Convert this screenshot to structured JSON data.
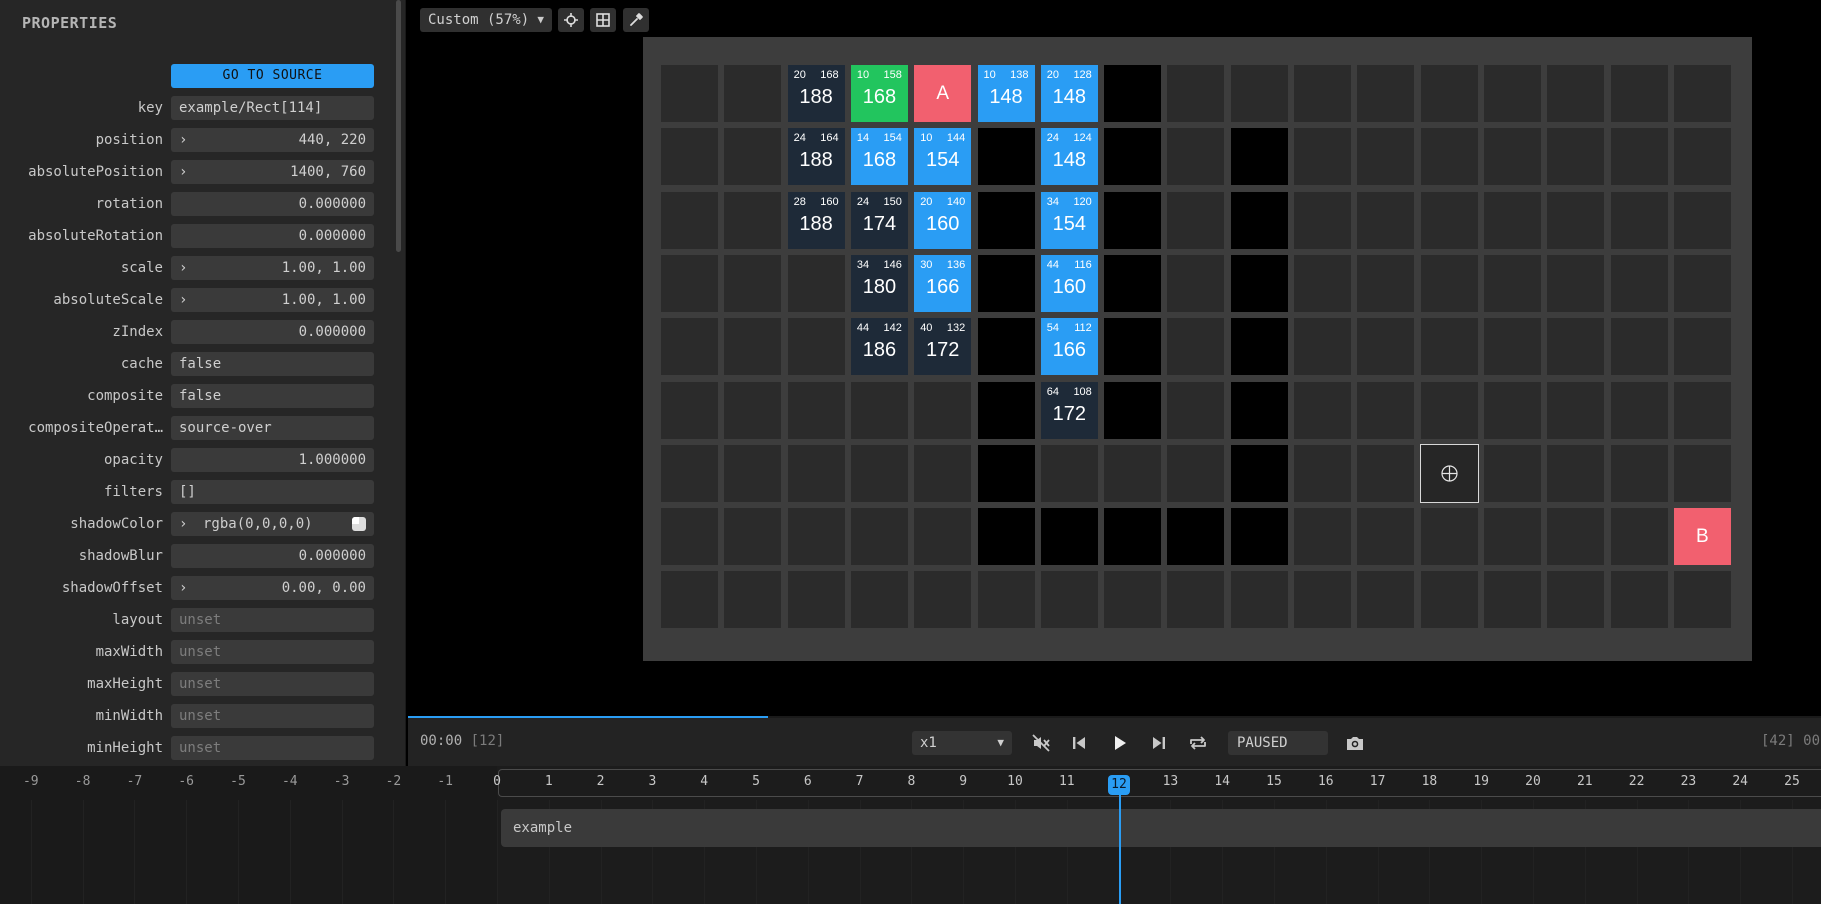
{
  "properties": {
    "title": "PROPERTIES",
    "go_to_source": "GO TO SOURCE",
    "rows": [
      {
        "label": "key",
        "value": "example/Rect[114]",
        "align": "left"
      },
      {
        "label": "position",
        "value": "440, 220",
        "align": "right",
        "expand": true
      },
      {
        "label": "absolutePosition",
        "value": "1400, 760",
        "align": "right",
        "expand": true
      },
      {
        "label": "rotation",
        "value": "0.000000",
        "align": "right"
      },
      {
        "label": "absoluteRotation",
        "value": "0.000000",
        "align": "right"
      },
      {
        "label": "scale",
        "value": "1.00, 1.00",
        "align": "right",
        "expand": true
      },
      {
        "label": "absoluteScale",
        "value": "1.00, 1.00",
        "align": "right",
        "expand": true
      },
      {
        "label": "zIndex",
        "value": "0.000000",
        "align": "right"
      },
      {
        "label": "cache",
        "value": "false",
        "align": "left"
      },
      {
        "label": "composite",
        "value": "false",
        "align": "left"
      },
      {
        "label": "compositeOperat…",
        "value": "source-over",
        "align": "left"
      },
      {
        "label": "opacity",
        "value": "1.000000",
        "align": "right"
      },
      {
        "label": "filters",
        "value": "[]",
        "align": "left"
      },
      {
        "label": "shadowColor",
        "value": "rgba(0,0,0,0)",
        "align": "left",
        "expand": true,
        "swatch": true
      },
      {
        "label": "shadowBlur",
        "value": "0.000000",
        "align": "right"
      },
      {
        "label": "shadowOffset",
        "value": "0.00, 0.00",
        "align": "right",
        "expand": true
      },
      {
        "label": "layout",
        "value": "unset",
        "align": "left",
        "muted": true
      },
      {
        "label": "maxWidth",
        "value": "unset",
        "align": "left",
        "muted": true
      },
      {
        "label": "maxHeight",
        "value": "unset",
        "align": "left",
        "muted": true
      },
      {
        "label": "minWidth",
        "value": "unset",
        "align": "left",
        "muted": true
      },
      {
        "label": "minHeight",
        "value": "unset",
        "align": "left",
        "muted": true
      }
    ]
  },
  "toolbar": {
    "zoom": "Custom (57%)",
    "icons": [
      "crosshair-icon",
      "grid-icon",
      "eyedropper-icon"
    ]
  },
  "grid": {
    "cols": 17,
    "rows": 9,
    "walls": [
      [
        7,
        0
      ],
      [
        7,
        1
      ],
      [
        7,
        2
      ],
      [
        7,
        3
      ],
      [
        7,
        4
      ],
      [
        7,
        5
      ],
      [
        9,
        1
      ],
      [
        9,
        2
      ],
      [
        9,
        3
      ],
      [
        9,
        4
      ],
      [
        9,
        5
      ],
      [
        9,
        6
      ],
      [
        5,
        1
      ],
      [
        5,
        2
      ],
      [
        5,
        3
      ],
      [
        5,
        4
      ],
      [
        5,
        5
      ],
      [
        5,
        6
      ],
      [
        5,
        7
      ],
      [
        6,
        7
      ],
      [
        7,
        7
      ],
      [
        8,
        7
      ],
      [
        9,
        7
      ]
    ],
    "nodes": [
      {
        "c": 2,
        "r": 0,
        "g": "20",
        "h": "168",
        "f": "188",
        "kind": "dark"
      },
      {
        "c": 3,
        "r": 0,
        "g": "10",
        "h": "158",
        "f": "168",
        "kind": "green"
      },
      {
        "c": 5,
        "r": 0,
        "g": "10",
        "h": "138",
        "f": "148",
        "kind": "blue"
      },
      {
        "c": 6,
        "r": 0,
        "g": "20",
        "h": "128",
        "f": "148",
        "kind": "blue"
      },
      {
        "c": 2,
        "r": 1,
        "g": "24",
        "h": "164",
        "f": "188",
        "kind": "dark"
      },
      {
        "c": 3,
        "r": 1,
        "g": "14",
        "h": "154",
        "f": "168",
        "kind": "blue"
      },
      {
        "c": 4,
        "r": 1,
        "g": "10",
        "h": "144",
        "f": "154",
        "kind": "blue"
      },
      {
        "c": 6,
        "r": 1,
        "g": "24",
        "h": "124",
        "f": "148",
        "kind": "blue"
      },
      {
        "c": 2,
        "r": 2,
        "g": "28",
        "h": "160",
        "f": "188",
        "kind": "dark"
      },
      {
        "c": 3,
        "r": 2,
        "g": "24",
        "h": "150",
        "f": "174",
        "kind": "dark"
      },
      {
        "c": 4,
        "r": 2,
        "g": "20",
        "h": "140",
        "f": "160",
        "kind": "blue"
      },
      {
        "c": 6,
        "r": 2,
        "g": "34",
        "h": "120",
        "f": "154",
        "kind": "blue"
      },
      {
        "c": 3,
        "r": 3,
        "g": "34",
        "h": "146",
        "f": "180",
        "kind": "dark"
      },
      {
        "c": 4,
        "r": 3,
        "g": "30",
        "h": "136",
        "f": "166",
        "kind": "blue"
      },
      {
        "c": 6,
        "r": 3,
        "g": "44",
        "h": "116",
        "f": "160",
        "kind": "blue"
      },
      {
        "c": 3,
        "r": 4,
        "g": "44",
        "h": "142",
        "f": "186",
        "kind": "dark"
      },
      {
        "c": 4,
        "r": 4,
        "g": "40",
        "h": "132",
        "f": "172",
        "kind": "dark"
      },
      {
        "c": 6,
        "r": 4,
        "g": "54",
        "h": "112",
        "f": "166",
        "kind": "blue"
      },
      {
        "c": 6,
        "r": 5,
        "g": "64",
        "h": "108",
        "f": "172",
        "kind": "dark"
      }
    ],
    "start": {
      "c": 4,
      "r": 0,
      "label": "A"
    },
    "goal": {
      "c": 16,
      "r": 7,
      "label": "B"
    },
    "cursor": {
      "c": 12,
      "r": 6
    }
  },
  "playback": {
    "time": "00:00",
    "frame": "[12]",
    "speed": "x1",
    "status": "PAUSED",
    "end_frame": "[42] 00:",
    "progress": 0.255,
    "icons": [
      "mute-icon",
      "prev-frame-icon",
      "play-icon",
      "next-frame-icon",
      "loop-icon",
      "camera-icon"
    ]
  },
  "timeline": {
    "ticks": [
      "-9",
      "-8",
      "-7",
      "-6",
      "-5",
      "-4",
      "-3",
      "-2",
      "-1",
      "0",
      "1",
      "2",
      "3",
      "4",
      "5",
      "6",
      "7",
      "8",
      "9",
      "10",
      "11",
      "12",
      "13",
      "14",
      "15",
      "16",
      "17",
      "18",
      "19",
      "20",
      "21",
      "22",
      "23",
      "24",
      "25"
    ],
    "current": "12",
    "clip": "example"
  }
}
